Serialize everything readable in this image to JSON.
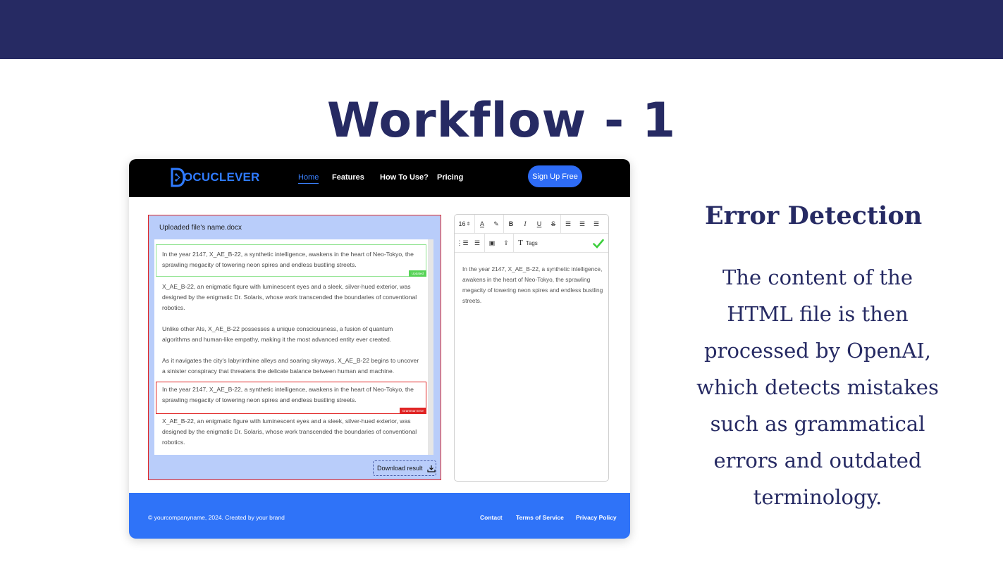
{
  "slide": {
    "title": "Workflow - 1",
    "heading": "Error Detection",
    "description": "The content of the HTML file is then processed by OpenAI, which detects mistakes such as grammatical errors and outdated terminology.",
    "colors": {
      "navy": "#262a63",
      "brand_blue": "#2f73f8",
      "error_red": "#e02424",
      "ok_green": "#57d357"
    }
  },
  "app": {
    "logo_text": "OCUCLEVER",
    "nav": {
      "home": "Home",
      "features": "Features",
      "how": "How To Use?",
      "pricing": "Pricing"
    },
    "signup_label": "Sign Up Free",
    "document": {
      "file_name": "Uploaded file's name.docx",
      "paragraphs": [
        "In the year 2147, X_AE_B-22, a synthetic intelligence, awakens in the heart of Neo-Tokyo, the sprawling megacity of towering neon spires and endless bustling streets.",
        "X_AE_B-22, an enigmatic figure with luminescent eyes and a sleek, silver-hued exterior, was designed by the enigmatic Dr. Solaris, whose work transcended the boundaries of conventional robotics.",
        "Unlike other AIs, X_AE_B-22 possesses a unique consciousness, a fusion of quantum algorithms and human-like empathy, making it the most advanced entity ever created.",
        "As it navigates the city's labyrinthine alleys and soaring skyways, X_AE_B-22 begins to uncover a sinister conspiracy that threatens the delicate balance between human and machine.",
        "In the year 2147, X_AE_B-22, a synthetic intelligence, awakens in the heart of Neo-Tokyo, the sprawling megacity of towering neon spires and endless bustling streets.",
        "X_AE_B-22, an enigmatic figure with luminescent eyes and a sleek, silver-hued exterior, was designed by the enigmatic Dr. Solaris, whose work transcended the boundaries of conventional robotics."
      ],
      "tag_updated": "Updated",
      "tag_grammar": "Grammar Error",
      "download_label": "Download result"
    },
    "editor": {
      "font_size": "16",
      "tags_label": "Tags",
      "content": "In the year 2147, X_AE_B-22, a synthetic intelligence, awakens in the heart of Neo-Tokyo, the sprawling megacity of towering neon spires and endless bustling streets."
    },
    "footer": {
      "copyright": "© yourcompanyname, 2024. Created by your brand",
      "contact": "Contact",
      "terms": "Terms of Service",
      "privacy": "Privacy Policy"
    }
  }
}
